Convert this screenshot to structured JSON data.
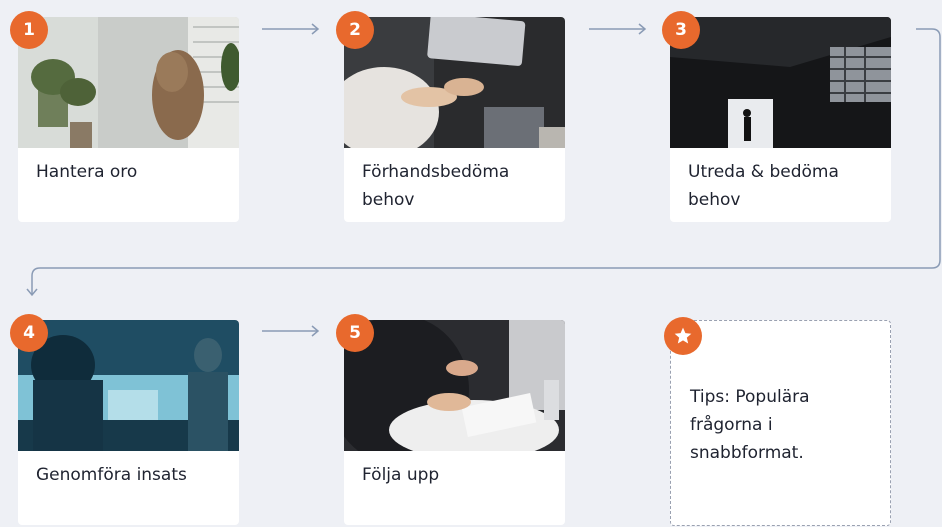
{
  "steps": [
    {
      "number": "1",
      "label": "Hantera oro",
      "image_icon": "person-in-hood-by-window-photo"
    },
    {
      "number": "2",
      "label": "Förhandsbedöma behov",
      "image_icon": "hands-at-laptop-photo"
    },
    {
      "number": "3",
      "label": "Utreda & bedöma behov",
      "image_icon": "figure-in-dark-doorway-photo"
    },
    {
      "number": "4",
      "label": "Genomföra insats",
      "image_icon": "meeting-room-blue-photo"
    },
    {
      "number": "5",
      "label": "Följa upp",
      "image_icon": "hands-with-papers-photo"
    }
  ],
  "tips": {
    "label": "Tips: Populära frågorna i snabbformat.",
    "icon": "star-icon"
  },
  "colors": {
    "accent": "#e8692d",
    "background": "#eef0f5",
    "card": "#ffffff",
    "connector": "#8a9bb5"
  }
}
